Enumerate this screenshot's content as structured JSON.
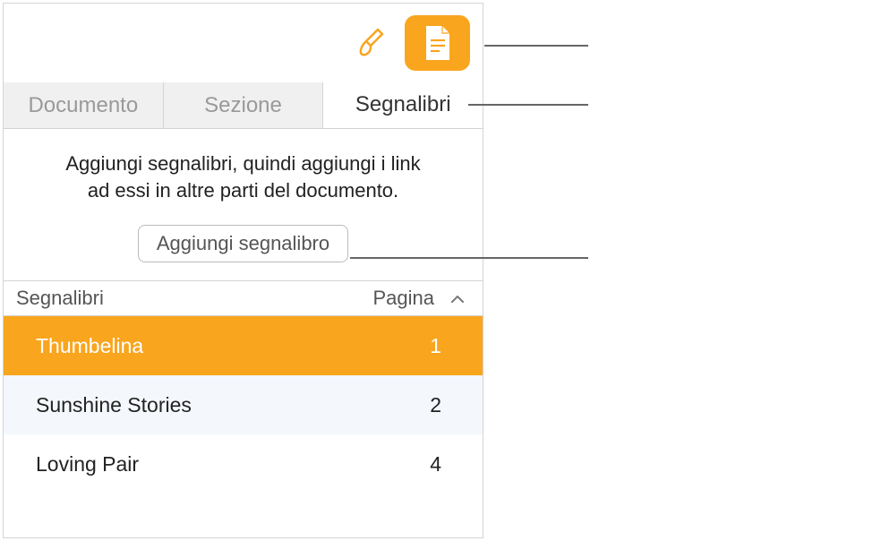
{
  "tabs": [
    {
      "label": "Documento"
    },
    {
      "label": "Sezione"
    },
    {
      "label": "Segnalibri"
    }
  ],
  "activeTab": 2,
  "help_text_line1": "Aggiungi segnalibri, quindi aggiungi i link",
  "help_text_line2": "ad essi in altre parti del documento.",
  "add_button_label": "Aggiungi segnalibro",
  "table": {
    "header_name": "Segnalibri",
    "header_page": "Pagina",
    "rows": [
      {
        "name": "Thumbelina",
        "page": "1",
        "selected": true
      },
      {
        "name": "Sunshine Stories",
        "page": "2",
        "selected": false
      },
      {
        "name": "Loving Pair",
        "page": "4",
        "selected": false
      }
    ]
  }
}
